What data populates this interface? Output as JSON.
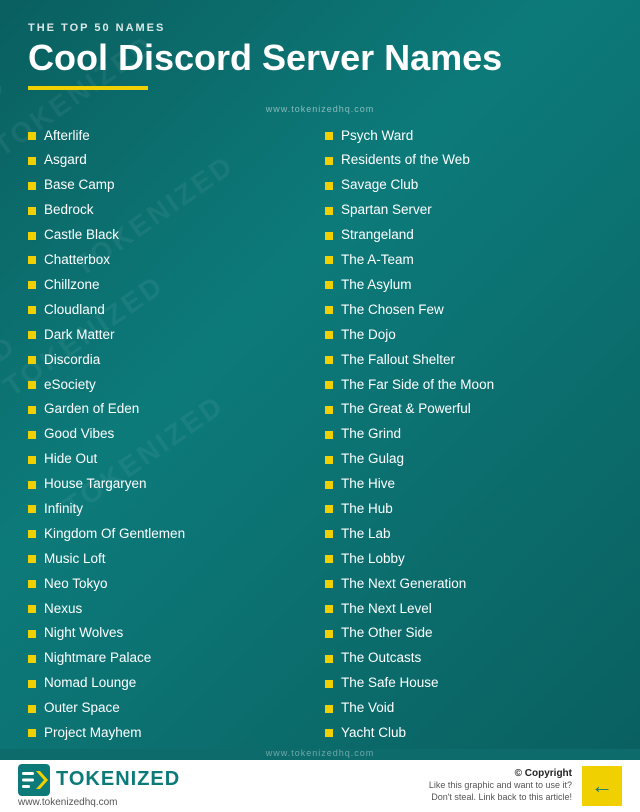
{
  "header": {
    "top_label": "THE TOP 50 NAMES",
    "main_title": "Cool Discord Server Names",
    "website": "www.tokenizedhq.com"
  },
  "left_column": [
    "Afterlife",
    "Asgard",
    "Base Camp",
    "Bedrock",
    "Castle Black",
    "Chatterbox",
    "Chillzone",
    "Cloudland",
    "Dark Matter",
    "Discordia",
    "eSociety",
    "Garden of Eden",
    "Good Vibes",
    "Hide Out",
    "House Targaryen",
    "Infinity",
    "Kingdom Of Gentlemen",
    "Music Loft",
    "Neo Tokyo",
    "Nexus",
    "Night Wolves",
    "Nightmare Palace",
    "Nomad Lounge",
    "Outer Space",
    "Project Mayhem"
  ],
  "right_column": [
    "Psych Ward",
    "Residents of the Web",
    "Savage Club",
    "Spartan Server",
    "Strangeland",
    "The A-Team",
    "The Asylum",
    "The Chosen Few",
    "The Dojo",
    "The Fallout Shelter",
    "The Far Side of the Moon",
    "The Great & Powerful",
    "The Grind",
    "The Gulag",
    "The Hive",
    "The Hub",
    "The Lab",
    "The Lobby",
    "The Next Generation",
    "The Next Level",
    "The Other Side",
    "The Outcasts",
    "The Safe House",
    "The Void",
    "Yacht Club"
  ],
  "footer": {
    "logo_text": "TOKENIZED",
    "website": "www.tokenizedhq.com",
    "copyright": "© Copyright",
    "desc_line1": "Like this graphic and want to use it?",
    "desc_line2": "Don't steal. Link back to this article!"
  },
  "mid_watermark": "www.tokenizedhq.com"
}
